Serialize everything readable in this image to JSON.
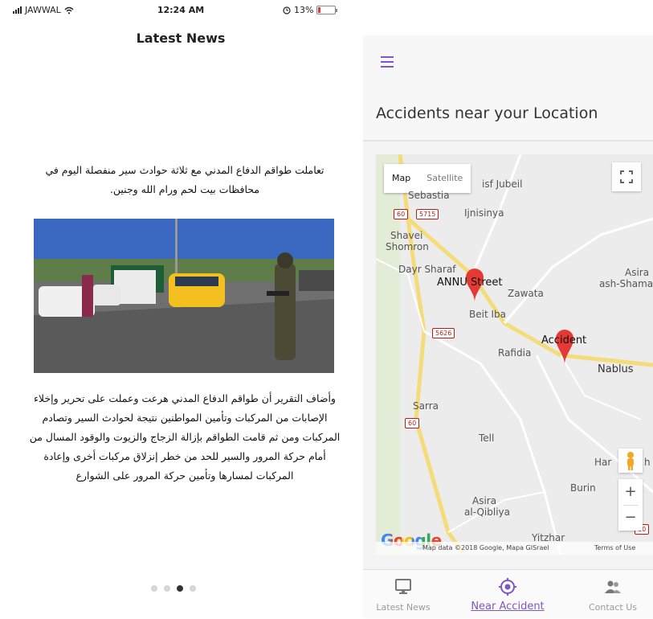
{
  "status_bar": {
    "carrier": "JAWWAL",
    "time": "12:24 AM",
    "battery_text": "13%",
    "battery_level": 0.13
  },
  "left_screen": {
    "title": "Latest News",
    "intro_text": "تعاملت طواقم الدفاع المدني مع ثلاثة حوادث سير منفصلة اليوم في محافظات بيت لحم ورام الله وجنين.",
    "body_text": "وأضاف التقرير أن طواقم الدفاع المدني هرعت وعملت على تحرير وإخلاء الإصابات من المركبات وتأمين المواطنين نتيجة لحوادث السير وتصادم المركبات ومن ثم قامت الطواقم بإزالة الزجاج والزيوت والوقود المسال من أمام حركة المرور والسير للحد من خطر إنزلاق مركبات أخرى وإعادة المركبات لمسارها وتأمين حركة المرور على الشوارع",
    "pagination": {
      "total": 4,
      "active": 3
    }
  },
  "right_screen": {
    "app_title": "Accidents near your Location",
    "map": {
      "type_map": "Map",
      "type_satellite": "Satellite",
      "labels": {
        "jubeil": "isf Jubeil",
        "sebastia": "Sebastia",
        "ijnisinya": "Ijnisinya",
        "shavei": "Shavei",
        "shomron": "Shomron",
        "dayr_sharaf": "Dayr Sharaf",
        "zawata": "Zawata",
        "beit_iba": "Beit Iba",
        "asira": "Asira",
        "ash_shamal": "ash-Shama",
        "rafidia": "Rafidia",
        "nablus": "Nablus",
        "sarra": "Sarra",
        "tell": "Tell",
        "har": "Har",
        "h": "h",
        "burin": "Burin",
        "asira_q": "Asira",
        "qibliya": "al-Qibliya",
        "yitzhar": "Yitzhar"
      },
      "road_shields": {
        "r60a": "60",
        "r5715": "5715",
        "r5626": "5626",
        "r60b": "60",
        "r60c": "60"
      },
      "markers": [
        {
          "label": "ANNU Street"
        },
        {
          "label": "Accident"
        }
      ],
      "zoom_in": "+",
      "zoom_out": "−",
      "google": "Google",
      "map_data": "Map data ©2018 Google, Mapa GISrael",
      "terms": "Terms of Use"
    },
    "bottom_nav": [
      {
        "label": "Latest News",
        "icon": "monitor-icon",
        "active": false
      },
      {
        "label": "Near Accident",
        "icon": "target-icon",
        "active": true
      },
      {
        "label": "Contact Us",
        "icon": "people-icon",
        "active": false
      }
    ]
  },
  "colors": {
    "accent": "#7e57c2",
    "marker": "#e53935",
    "map_bg": "#ececec",
    "road_yellow": "#f4dc7a"
  }
}
